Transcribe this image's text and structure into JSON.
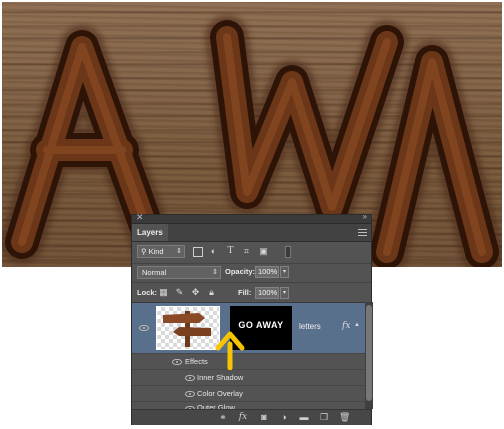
{
  "canvas": {
    "text": "AWA",
    "color_wood": "#7a5a3e",
    "color_burn": "#3a1c0a"
  },
  "panel": {
    "title": "Layers",
    "filter": {
      "label": "Kind",
      "icon": "search-icon"
    },
    "blend_mode": "Normal",
    "opacity_label": "Opacity:",
    "opacity_value": "100%",
    "lock_label": "Lock:",
    "fill_label": "Fill:",
    "fill_value": "100%"
  },
  "layer": {
    "name": "letters",
    "mask_text": "GO AWAY",
    "fx_label": "fx",
    "effects_label": "Effects",
    "effects": [
      "Inner Shadow",
      "Color Overlay",
      "Outer Glow"
    ]
  },
  "colors": {
    "panel_bg": "#535353",
    "selected_row": "#59708c",
    "annotation_arrow": "#f6c400"
  }
}
